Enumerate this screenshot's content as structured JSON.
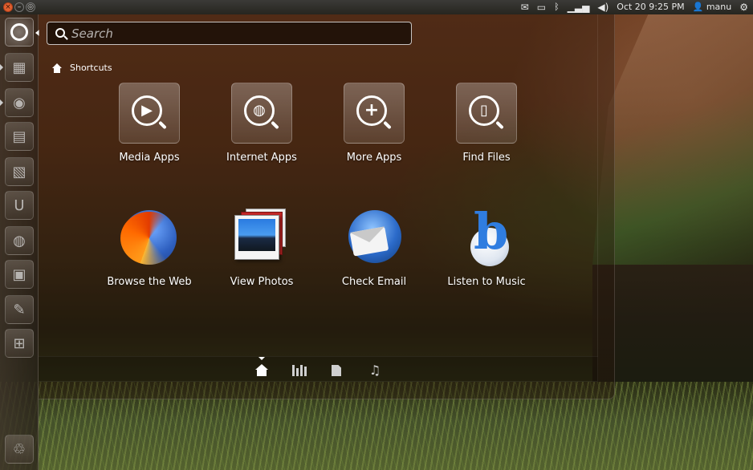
{
  "top_panel": {
    "window_buttons": {
      "close": "×",
      "minimize": "–",
      "maximize": "◎"
    },
    "indicators": {
      "mail_icon": "mail-icon",
      "battery_icon": "battery-icon",
      "bluetooth_icon": "bluetooth-icon",
      "network_icon": "network-icon",
      "volume_icon": "volume-icon",
      "clock": "Oct 20  9:25 PM",
      "user_name": "manu",
      "session_icon": "gear-icon"
    }
  },
  "launcher": {
    "items": [
      {
        "name": "dash-home-button",
        "icon": "ubuntu-logo-icon"
      },
      {
        "name": "launcher-item-1",
        "icon": "app-grid-icon"
      },
      {
        "name": "launcher-item-2",
        "icon": "optical-disc-icon"
      },
      {
        "name": "launcher-item-3",
        "icon": "file-manager-icon"
      },
      {
        "name": "launcher-item-4",
        "icon": "software-center-icon"
      },
      {
        "name": "launcher-item-5",
        "icon": "ubuntu-one-icon"
      },
      {
        "name": "launcher-item-6",
        "icon": "web-globe-icon"
      },
      {
        "name": "launcher-item-7",
        "icon": "terminal-icon"
      },
      {
        "name": "launcher-item-8",
        "icon": "tools-icon"
      },
      {
        "name": "launcher-item-9",
        "icon": "workspaces-icon"
      },
      {
        "name": "launcher-trash",
        "icon": "trash-icon"
      }
    ]
  },
  "dash": {
    "search": {
      "placeholder": "Search",
      "value": ""
    },
    "section_title": "Shortcuts",
    "shortcuts": [
      {
        "label": "Media Apps",
        "icon": "play-icon"
      },
      {
        "label": "Internet Apps",
        "icon": "globe-icon"
      },
      {
        "label": "More Apps",
        "icon": "plus-icon"
      },
      {
        "label": "Find Files",
        "icon": "document-icon"
      }
    ],
    "apps": [
      {
        "label": "Browse the Web",
        "icon": "firefox-icon"
      },
      {
        "label": "View Photos",
        "icon": "photos-icon"
      },
      {
        "label": "Check Email",
        "icon": "thunderbird-icon"
      },
      {
        "label": "Listen to Music",
        "icon": "banshee-icon"
      }
    ],
    "lens_bar": {
      "active": "home",
      "lenses": [
        "home-lens-icon",
        "applications-lens-icon",
        "files-lens-icon",
        "music-lens-icon"
      ]
    }
  }
}
